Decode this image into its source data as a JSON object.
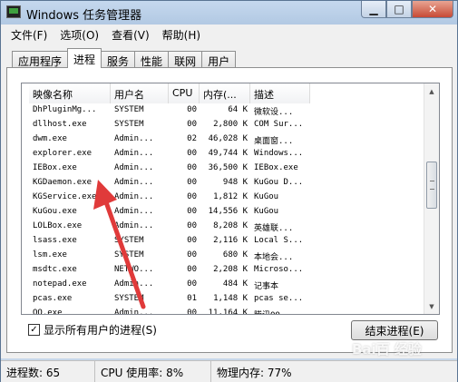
{
  "window": {
    "title": "Windows 任务管理器"
  },
  "title_buttons": {
    "minimize": "▁",
    "maximize": "□",
    "close": "✕"
  },
  "menu": [
    "文件(F)",
    "选项(O)",
    "查看(V)",
    "帮助(H)"
  ],
  "tabs": [
    {
      "label": "应用程序",
      "active": false
    },
    {
      "label": "进程",
      "active": true
    },
    {
      "label": "服务",
      "active": false
    },
    {
      "label": "性能",
      "active": false
    },
    {
      "label": "联网",
      "active": false
    },
    {
      "label": "用户",
      "active": false
    }
  ],
  "columns": [
    "映像名称",
    "用户名",
    "CPU",
    "内存(...",
    "描述"
  ],
  "processes": [
    {
      "name": "DhPluginMg...",
      "user": "SYSTEM",
      "cpu": "00",
      "mem": "64 K",
      "desc": "微软设..."
    },
    {
      "name": "dllhost.exe",
      "user": "SYSTEM",
      "cpu": "00",
      "mem": "2,800 K",
      "desc": "COM Sur..."
    },
    {
      "name": "dwm.exe",
      "user": "Admin...",
      "cpu": "02",
      "mem": "46,028 K",
      "desc": "桌面窗..."
    },
    {
      "name": "explorer.exe",
      "user": "Admin...",
      "cpu": "00",
      "mem": "49,744 K",
      "desc": "Windows..."
    },
    {
      "name": "IEBox.exe",
      "user": "Admin...",
      "cpu": "00",
      "mem": "36,500 K",
      "desc": "IEBox.exe"
    },
    {
      "name": "KGDaemon.exe",
      "user": "Admin...",
      "cpu": "00",
      "mem": "948 K",
      "desc": "KuGou D..."
    },
    {
      "name": "KGService.exe",
      "user": "Admin...",
      "cpu": "00",
      "mem": "1,812 K",
      "desc": "KuGou"
    },
    {
      "name": "KuGou.exe",
      "user": "Admin...",
      "cpu": "00",
      "mem": "14,556 K",
      "desc": "KuGou"
    },
    {
      "name": "LOLBox.exe",
      "user": "Admin...",
      "cpu": "00",
      "mem": "8,208 K",
      "desc": "英雄联..."
    },
    {
      "name": "lsass.exe",
      "user": "SYSTEM",
      "cpu": "00",
      "mem": "2,116 K",
      "desc": "Local S..."
    },
    {
      "name": "lsm.exe",
      "user": "SYSTEM",
      "cpu": "00",
      "mem": "680 K",
      "desc": "本地会..."
    },
    {
      "name": "msdtc.exe",
      "user": "NETWO...",
      "cpu": "00",
      "mem": "2,208 K",
      "desc": "Microso..."
    },
    {
      "name": "notepad.exe",
      "user": "Admin...",
      "cpu": "00",
      "mem": "484 K",
      "desc": "记事本"
    },
    {
      "name": "pcas.exe",
      "user": "SYSTEM",
      "cpu": "01",
      "mem": "1,148 K",
      "desc": "pcas se..."
    },
    {
      "name": "QQ.exe",
      "user": "Admin...",
      "cpu": "00",
      "mem": "11,164 K",
      "desc": "腾讯QQ"
    }
  ],
  "show_all": {
    "label": "显示所有用户的进程(S)",
    "checked": true,
    "mark": "✓"
  },
  "end_process": {
    "label": "结束进程(E)"
  },
  "status": {
    "processes": "进程数: 65",
    "cpu": "CPU 使用率: 8%",
    "memory": "物理内存: 77%"
  },
  "annotation_color": "#e03a3a",
  "watermark": "Bai百 经验"
}
